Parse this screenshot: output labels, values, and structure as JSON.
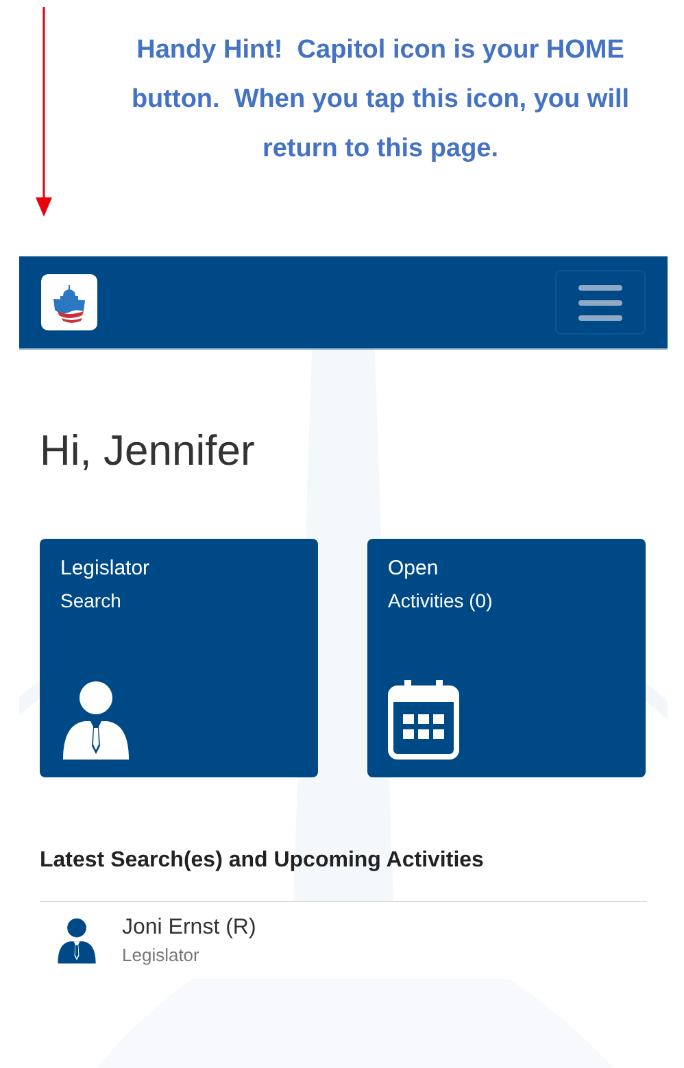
{
  "hint": {
    "text": "Handy Hint!  Capitol icon is your HOME button.  When you tap this icon, you will return to this page."
  },
  "greeting": "Hi, Jennifer",
  "tiles": [
    {
      "kind": "person",
      "title": "Legislator",
      "subtitle": "Search"
    },
    {
      "kind": "calendar",
      "title": "Open",
      "subtitle": "Activities (0)"
    }
  ],
  "recent": {
    "heading": "Latest Search(es) and Upcoming Activities",
    "items": [
      {
        "kind": "person",
        "name": "Joni Ernst (R)",
        "role": "Legislator"
      }
    ]
  }
}
